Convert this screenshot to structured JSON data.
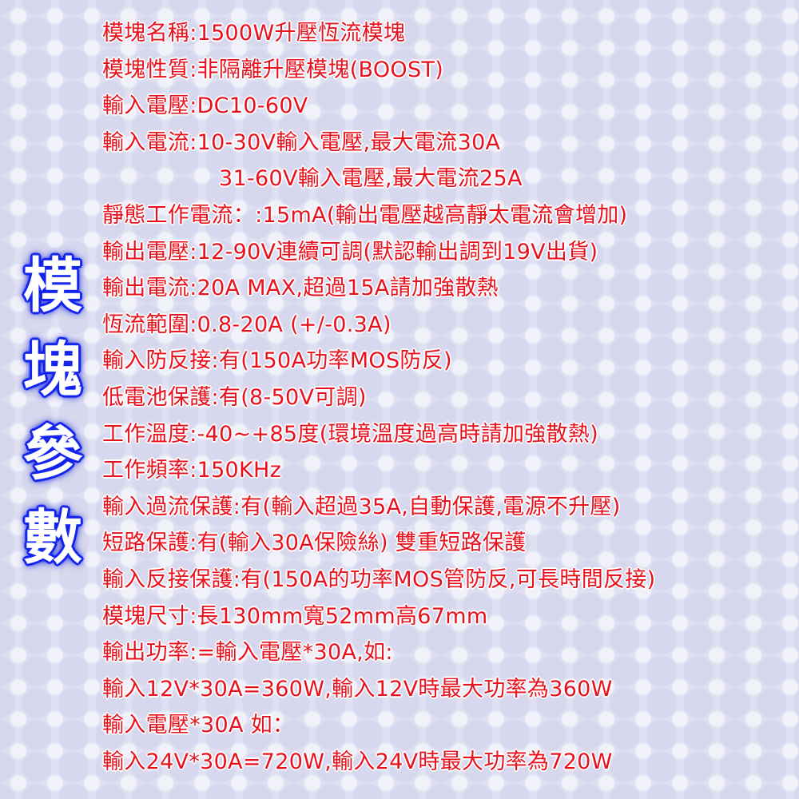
{
  "side_title": [
    "模",
    "塊",
    "參",
    "數"
  ],
  "lines": [
    {
      "text": "模塊名稱:1500W升壓恆流模塊"
    },
    {
      "text": "模塊性質:非隔離升壓模塊(BOOST)"
    },
    {
      "text": "輸入電壓:DC10-60V"
    },
    {
      "text": "輸入電流:10-30V輸入電壓,最大電流30A"
    },
    {
      "text": "31-60V輸入電壓,最大電流25A",
      "indent": true
    },
    {
      "text": "靜態工作電流：:15mA(輸出電壓越高靜太電流會增加)"
    },
    {
      "text": "輸出電壓:12-90V連續可調(默認輸出調到19V出貨)"
    },
    {
      "text": "輸出電流:20A MAX,超過15A請加強散熱"
    },
    {
      "text": "恆流範圍:0.8-20A (+/-0.3A)"
    },
    {
      "text": "輸入防反接:有(150A功率MOS防反)"
    },
    {
      "text": "低電池保護:有(8-50V可調)"
    },
    {
      "text": "工作溫度:-40~+85度(環境溫度過高時請加強散熱)"
    },
    {
      "text": "工作頻率:150KHz"
    },
    {
      "text": "輸入過流保護:有(輸入超過35A,自動保護,電源不升壓)"
    },
    {
      "text": "短路保護:有(輸入30A保險絲) 雙重短路保護"
    },
    {
      "text": "輸入反接保護:有(150A的功率MOS管防反,可長時間反接)"
    },
    {
      "text": "模塊尺寸:長130mm寬52mm高67mm"
    },
    {
      "text": "輸出功率:=輸入電壓*30A,如:"
    },
    {
      "text": "輸入12V*30A=360W,輸入12V時最大功率為360W"
    },
    {
      "text": "輸入電壓*30A 如："
    },
    {
      "text": "輸入24V*30A=720W,輸入24V時最大功率為720W"
    }
  ]
}
